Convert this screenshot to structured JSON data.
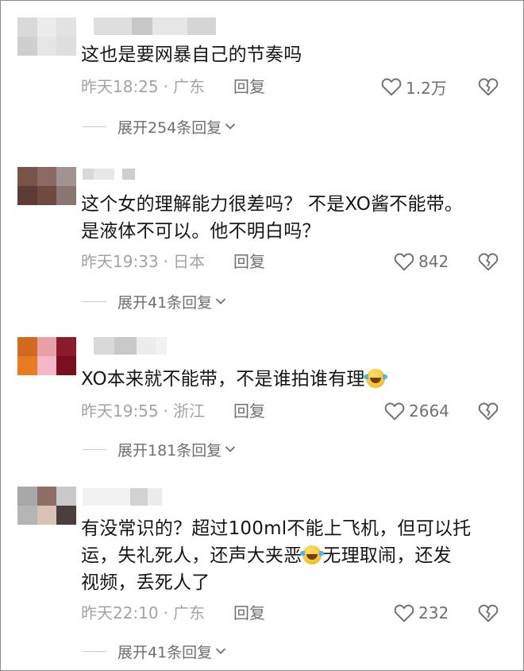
{
  "comments": [
    {
      "text_lines": [
        "这也是要网暴自己的节奏吗"
      ],
      "time": "昨天18:25",
      "location": "广东",
      "reply_label": "回复",
      "likes": "1.2万",
      "expand_label": "展开254条回复",
      "avatar_colors": [
        "#d9d9d9",
        "#ececec",
        "#e2e2e2",
        "#cfcfcf",
        "#e6e6e6",
        "#dedede"
      ]
    },
    {
      "text_lines": [
        "这个女的理解能力很差吗？ 不是XO酱不能带。",
        "是液体不可以。他不明白吗？"
      ],
      "time": "昨天19:33",
      "location": "日本",
      "reply_label": "回复",
      "likes": "842",
      "expand_label": "展开41条回复",
      "avatar_colors": [
        "#7a5348",
        "#8b6a64",
        "#a09392",
        "#5e3c35",
        "#6f4a40",
        "#8a7572"
      ]
    },
    {
      "text_line_1": "XO本来就不能带，不是谁拍谁有理",
      "time": "昨天19:55",
      "location": "浙江",
      "reply_label": "回复",
      "likes": "2664",
      "expand_label": "展开181条回复",
      "avatar_colors": [
        "#d2691e",
        "#e8a0a8",
        "#8b1a2a",
        "#e87a22",
        "#f4b8c8",
        "#7a0f1f"
      ]
    },
    {
      "line_1": "有没常识的？超过100ml不能上飞机，但可以托",
      "line_2a": "运，失礼死人，还声大夹恶",
      "line_2b": "无理取闹，还发",
      "line_3": "视频，丢死人了",
      "time": "昨天22:10",
      "location": "广东",
      "reply_label": "回复",
      "likes": "232",
      "expand_label": "展开41条回复",
      "avatar_colors": [
        "#a8a8a8",
        "#8e6f66",
        "#c9c9c9",
        "#b5b5b5",
        "#d8c2b8",
        "#4a3f3c"
      ]
    }
  ],
  "dot_separator": "·",
  "colors": {
    "text": "#161616",
    "meta": "#a3a3a3",
    "action": "#6f6f6f",
    "divider": "#c9c9c9"
  },
  "icons": {
    "like": "heart-outline-icon",
    "dislike": "broken-heart-icon",
    "expand": "chevron-down-icon"
  }
}
